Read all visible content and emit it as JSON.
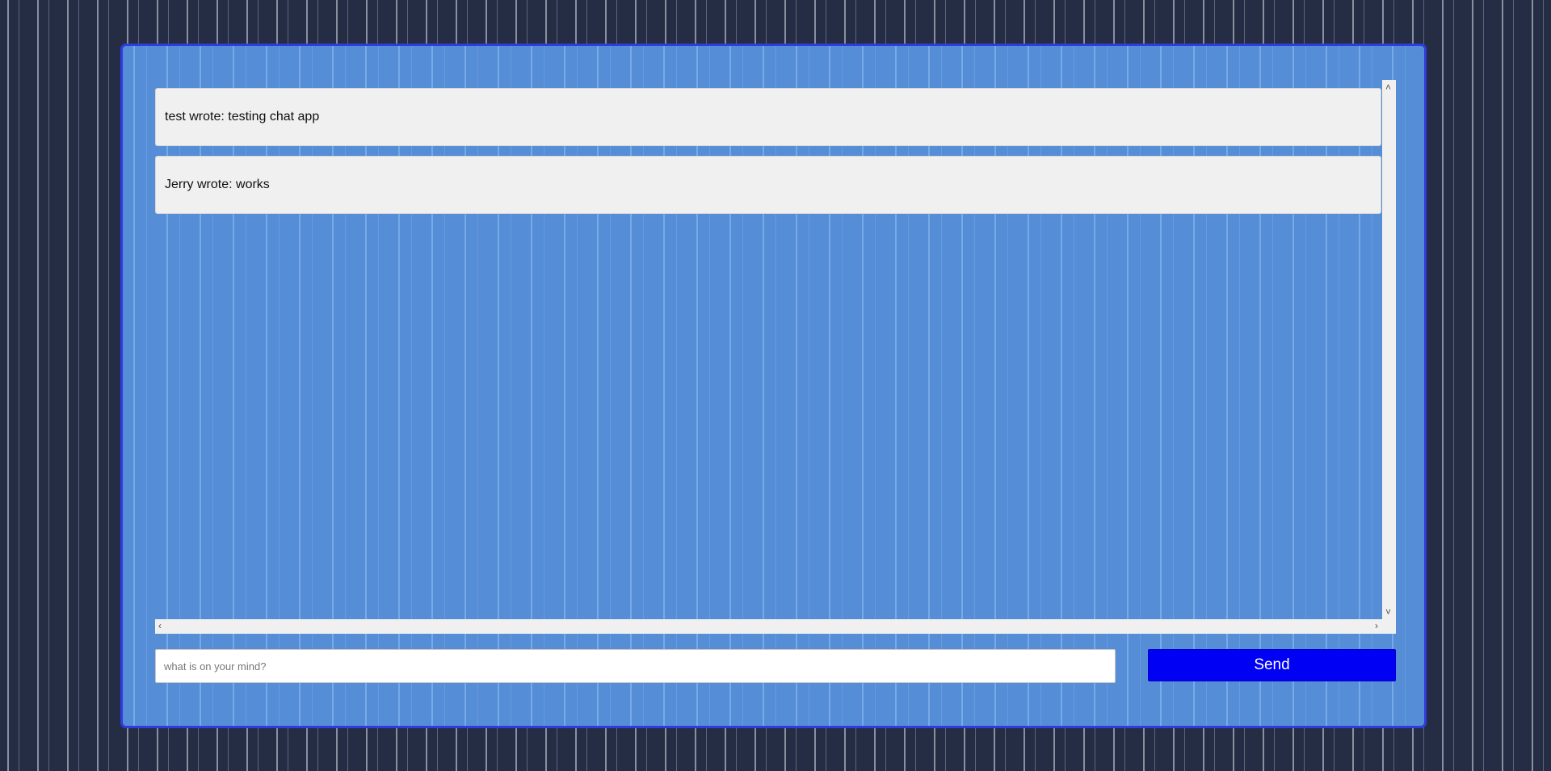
{
  "chat": {
    "messages": [
      {
        "text": "test wrote: testing chat app"
      },
      {
        "text": "Jerry wrote: works"
      }
    ]
  },
  "composer": {
    "placeholder": "what is on your mind?",
    "value": "",
    "send_label": "Send"
  },
  "icons": {
    "scroll_up": "caret-up-icon",
    "scroll_down": "caret-down-icon",
    "scroll_left": "caret-left-icon",
    "scroll_right": "caret-right-icon"
  },
  "colors": {
    "panel_bg": "#558dd6",
    "panel_border": "#2f3ce0",
    "send_button": "#0000f5",
    "page_bg": "#252d44"
  }
}
